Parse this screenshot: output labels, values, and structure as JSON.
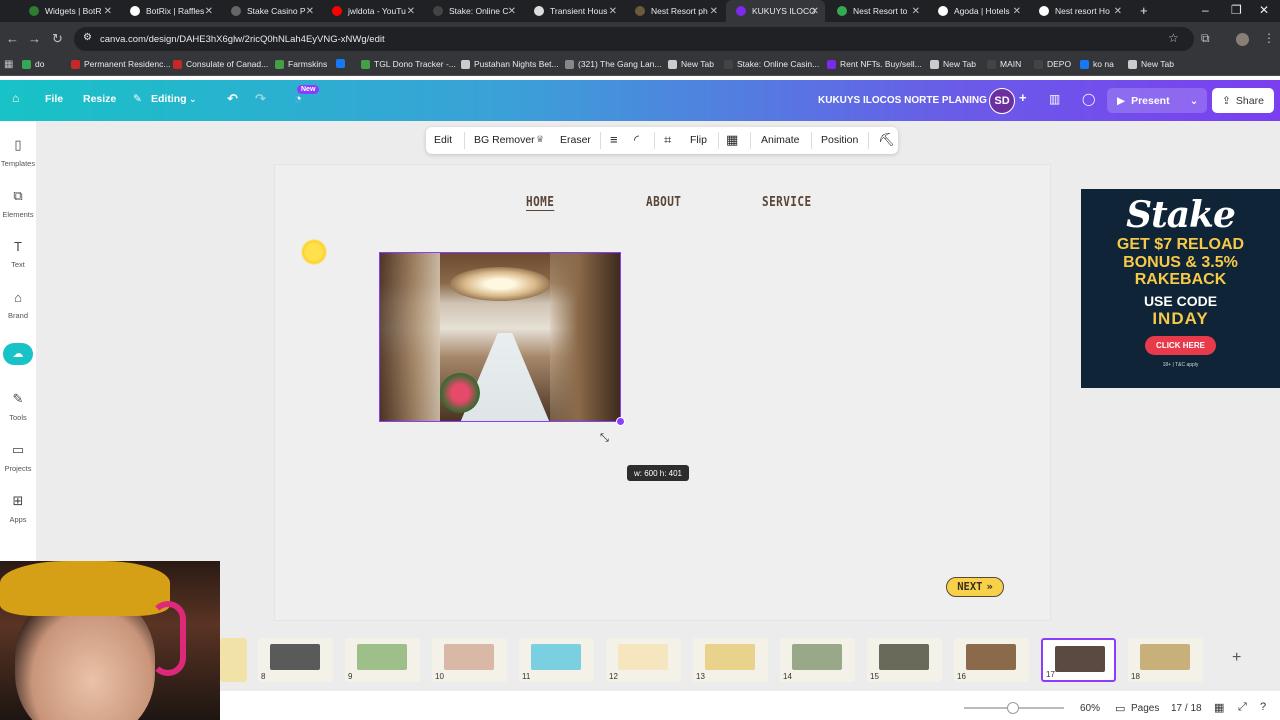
{
  "browser": {
    "tabs": [
      {
        "label": "Widgets | BotR",
        "color": "#2e7d32"
      },
      {
        "label": "BotRix | Raffles",
        "color": "#ffffff"
      },
      {
        "label": "Stake Casino P",
        "color": "#666666"
      },
      {
        "label": "jwldota - YouTu",
        "color": "#ff0000"
      },
      {
        "label": "Stake: Online C",
        "color": "#444444"
      },
      {
        "label": "Transient Hous",
        "color": "#dddddd"
      },
      {
        "label": "Nest Resort ph",
        "color": "#6b5b3a"
      },
      {
        "label": "KUKUYS ILOCO",
        "color": "#7d2ae8"
      },
      {
        "label": "Nest Resort to",
        "color": "#34a853"
      },
      {
        "label": "Agoda | Hotels",
        "color": "#ffffff"
      },
      {
        "label": "Nest resort Ho",
        "color": "#ffffff"
      }
    ],
    "url": "canva.com/design/DAHE3hX6glw/2ricQ0hNLah4EyVNG-xNWg/edit",
    "bookmarks": [
      {
        "label": "do",
        "color": "#34a853"
      },
      {
        "label": "Permanent Residenc...",
        "color": "#c62828"
      },
      {
        "label": "Consulate of Canad...",
        "color": "#c62828"
      },
      {
        "label": "Farmskins",
        "color": "#43a047"
      },
      {
        "label": "",
        "color": "#1877f2"
      },
      {
        "label": "TGL Dono Tracker -...",
        "color": "#43a047"
      },
      {
        "label": "Pustahan Nights Bet...",
        "color": "#cccccc"
      },
      {
        "label": "(321) The Gang Lan...",
        "color": "#888888"
      },
      {
        "label": "New Tab",
        "color": "#cccccc"
      },
      {
        "label": "Stake: Online Casin...",
        "color": "#444444"
      },
      {
        "label": "Rent NFTs. Buy/sell...",
        "color": "#7d2ae8"
      },
      {
        "label": "New Tab",
        "color": "#cccccc"
      },
      {
        "label": "MAIN",
        "color": "#444444"
      },
      {
        "label": "DEPO",
        "color": "#444444"
      },
      {
        "label": "ko na",
        "color": "#1877f2"
      },
      {
        "label": "New Tab",
        "color": "#cccccc"
      }
    ]
  },
  "header": {
    "file": "File",
    "resize": "Resize",
    "editing": "Editing",
    "new_badge": "New",
    "design_title": "KUKUYS ILOCOS NORTE PLANING",
    "avatar_initials": "SD",
    "present": "Present",
    "share": "Share"
  },
  "rail": [
    {
      "label": "Templates",
      "icon": "templates-icon"
    },
    {
      "label": "Elements",
      "icon": "elements-icon"
    },
    {
      "label": "Text",
      "icon": "text-icon"
    },
    {
      "label": "Brand",
      "icon": "brand-icon"
    },
    {
      "label": "",
      "icon": "magic-icon"
    },
    {
      "label": "Tools",
      "icon": "tools-icon"
    },
    {
      "label": "Projects",
      "icon": "projects-icon"
    },
    {
      "label": "Apps",
      "icon": "apps-icon"
    }
  ],
  "toolbar": {
    "edit": "Edit",
    "bg_remover": "BG Remover",
    "eraser": "Eraser",
    "flip": "Flip",
    "animate": "Animate",
    "position": "Position"
  },
  "page": {
    "nav": [
      "HOME",
      "ABOUT",
      "SERVICE"
    ],
    "dims": "w: 600 h: 401",
    "next": "NEXT"
  },
  "ad": {
    "brand": "Stake",
    "line1": "GET $7 RELOAD",
    "line2": "BONUS & 3.5%",
    "line3": "RAKEBACK",
    "use_code": "USE CODE",
    "code": "INDAY",
    "cta": "CLICK HERE",
    "terms": "18+ | T&C apply"
  },
  "thumbnails": [
    {
      "num": "8",
      "bg": "#5a5a5a"
    },
    {
      "num": "9",
      "bg": "#9fbf8a"
    },
    {
      "num": "10",
      "bg": "#d9b9a6"
    },
    {
      "num": "11",
      "bg": "#7ad0e0"
    },
    {
      "num": "12",
      "bg": "#f5e6c0"
    },
    {
      "num": "13",
      "bg": "#e8d28c"
    },
    {
      "num": "14",
      "bg": "#9aa88a"
    },
    {
      "num": "15",
      "bg": "#6a6a5a"
    },
    {
      "num": "16",
      "bg": "#8a6a4a"
    },
    {
      "num": "17",
      "bg": "#5a4a42"
    },
    {
      "num": "18",
      "bg": "#c8b07a"
    }
  ],
  "status": {
    "zoom": "60%",
    "pages": "Pages",
    "page_count": "17 / 18"
  },
  "colors": {
    "accent": "#8b3dff",
    "nav_text": "#5a4638",
    "next_bg": "#f7d14a"
  }
}
